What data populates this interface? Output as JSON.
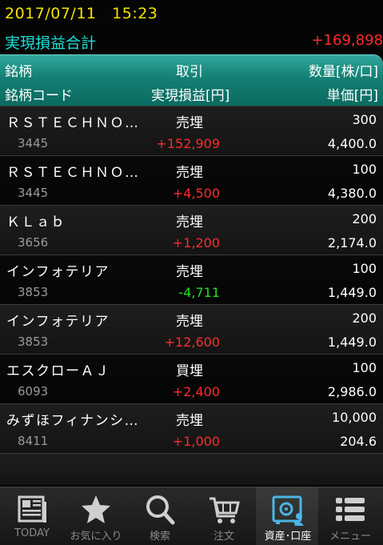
{
  "status": {
    "date": "2017/07/11",
    "time": "15:23"
  },
  "summary": {
    "label": "実現損益合計",
    "value": "+169,898"
  },
  "header": {
    "col_name": "銘柄",
    "col_trade": "取引",
    "col_qty": "数量[株/口]",
    "col_code": "銘柄コード",
    "col_pl": "実現損益[円]",
    "col_price": "単価[円]"
  },
  "rows": [
    {
      "name": "ＲＳＴＥＣＨＮＯ…",
      "trade": "売埋",
      "qty": "300",
      "code": "3445",
      "pl": "+152,909",
      "pl_sign": "pos",
      "price": "4,400.0"
    },
    {
      "name": "ＲＳＴＥＣＨＮＯ…",
      "trade": "売埋",
      "qty": "100",
      "code": "3445",
      "pl": "+4,500",
      "pl_sign": "pos",
      "price": "4,380.0"
    },
    {
      "name": "ＫＬａｂ",
      "trade": "売埋",
      "qty": "200",
      "code": "3656",
      "pl": "+1,200",
      "pl_sign": "pos",
      "price": "2,174.0"
    },
    {
      "name": "インフォテリア",
      "trade": "売埋",
      "qty": "100",
      "code": "3853",
      "pl": "-4,711",
      "pl_sign": "neg",
      "price": "1,449.0"
    },
    {
      "name": "インフォテリア",
      "trade": "売埋",
      "qty": "200",
      "code": "3853",
      "pl": "+12,600",
      "pl_sign": "pos",
      "price": "1,449.0"
    },
    {
      "name": "エスクローＡＪ",
      "trade": "買埋",
      "qty": "100",
      "code": "6093",
      "pl": "+2,400",
      "pl_sign": "pos",
      "price": "2,986.0"
    },
    {
      "name": "みずほフィナンシ…",
      "trade": "売埋",
      "qty": "10,000",
      "code": "8411",
      "pl": "+1,000",
      "pl_sign": "pos",
      "price": "204.6"
    }
  ],
  "tabs": [
    {
      "label": "TODAY",
      "icon": "newspaper-icon",
      "active": false
    },
    {
      "label": "お気に入り",
      "icon": "star-icon",
      "active": false
    },
    {
      "label": "検索",
      "icon": "magnifier-icon",
      "active": false
    },
    {
      "label": "注文",
      "icon": "cart-icon",
      "active": false
    },
    {
      "label": "資産･口座",
      "icon": "safe-icon",
      "active": true
    },
    {
      "label": "メニュー",
      "icon": "menu-list-icon",
      "active": false
    }
  ],
  "colors": {
    "date": "#f5e300",
    "summary_label": "#19e0d8",
    "positive": "#ff2a2a",
    "negative": "#22e022",
    "header": "#147f73"
  }
}
